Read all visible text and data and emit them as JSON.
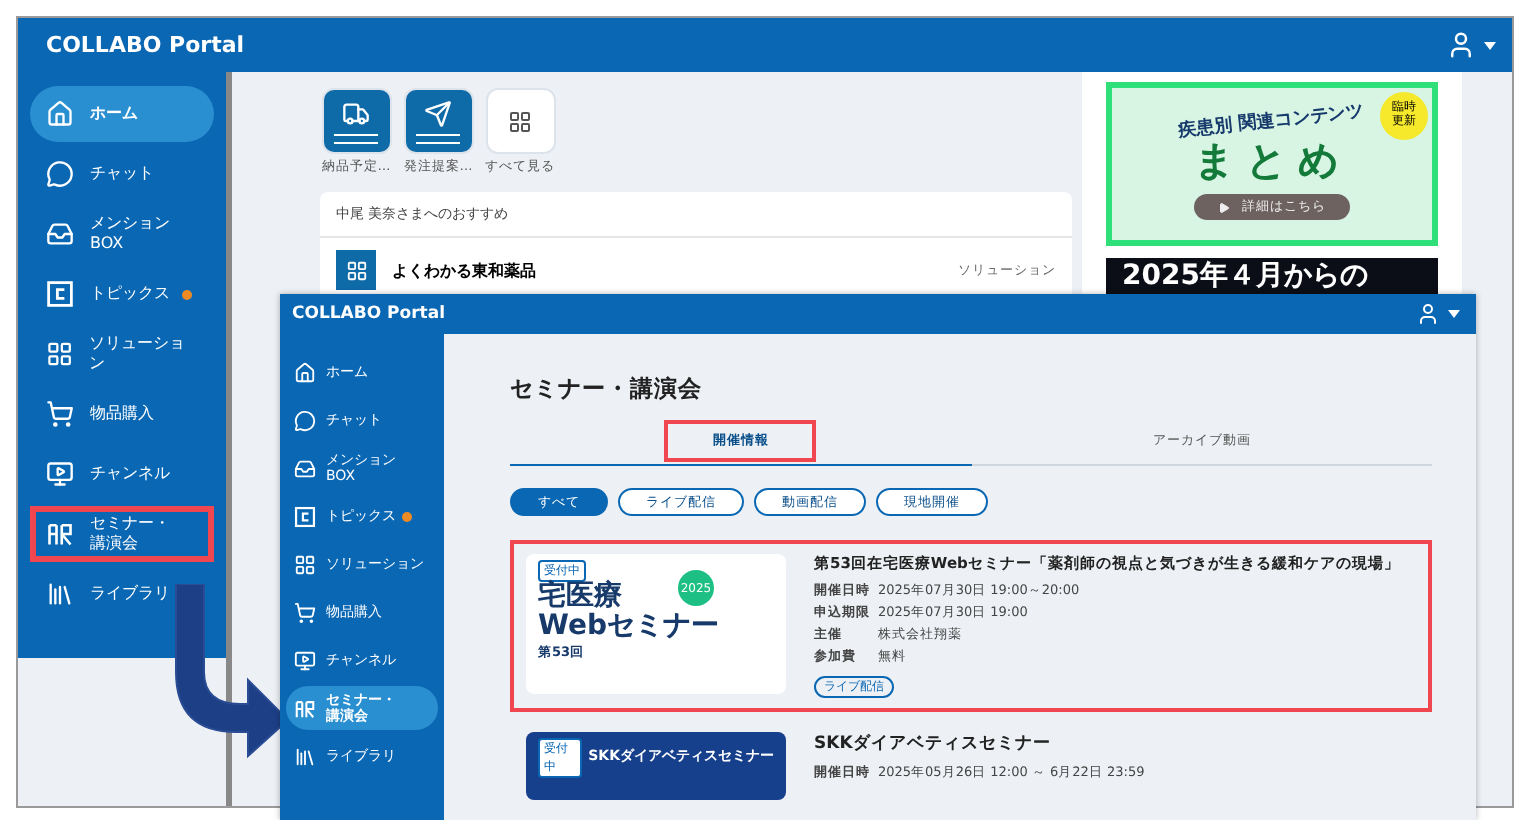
{
  "back_window": {
    "title": "COLLABO Portal",
    "sidebar": {
      "items": [
        {
          "label": "ホーム",
          "selected": true,
          "dot": false,
          "highlighted": false
        },
        {
          "label": "チャット",
          "selected": false,
          "dot": false,
          "highlighted": false
        },
        {
          "label": "メンション\nBOX",
          "selected": false,
          "dot": false,
          "highlighted": false
        },
        {
          "label": "トピックス",
          "selected": false,
          "dot": true,
          "highlighted": false
        },
        {
          "label": "ソリューション",
          "selected": false,
          "dot": false,
          "highlighted": false
        },
        {
          "label": "物品購入",
          "selected": false,
          "dot": false,
          "highlighted": false
        },
        {
          "label": "チャンネル",
          "selected": false,
          "dot": false,
          "highlighted": false
        },
        {
          "label": "セミナー・講演会",
          "selected": false,
          "dot": false,
          "highlighted": true
        },
        {
          "label": "ライブラリ",
          "selected": false,
          "dot": false,
          "highlighted": false
        }
      ]
    },
    "apps": [
      {
        "kind": "truck",
        "label": "納品予定…"
      },
      {
        "kind": "plane",
        "label": "発注提案…"
      },
      {
        "kind": "all",
        "label": "すべて見る"
      }
    ],
    "recommend": {
      "heading": "中尾 美奈さまへのおすすめ",
      "items": [
        {
          "title": "よくわかる東和薬品",
          "tag": "ソリューション"
        }
      ]
    },
    "banners": [
      {
        "kind": "flowers",
        "title": "疾患別 関連コンテンツ",
        "main": "まとめ",
        "badge": "臨時更新",
        "button": "詳細はこちら"
      },
      {
        "kind": "dark",
        "main": "2025年４月からの"
      }
    ]
  },
  "front_window": {
    "title": "COLLABO Portal",
    "sidebar": {
      "items": [
        {
          "label": "ホーム",
          "selected": false,
          "dot": false
        },
        {
          "label": "チャット",
          "selected": false,
          "dot": false
        },
        {
          "label": "メンション\nBOX",
          "selected": false,
          "dot": false
        },
        {
          "label": "トピックス",
          "selected": false,
          "dot": true
        },
        {
          "label": "ソリューション",
          "selected": false,
          "dot": false
        },
        {
          "label": "物品購入",
          "selected": false,
          "dot": false
        },
        {
          "label": "チャンネル",
          "selected": false,
          "dot": false
        },
        {
          "label": "セミナー・講演会",
          "selected": true,
          "dot": false
        },
        {
          "label": "ライブラリ",
          "selected": false,
          "dot": false
        }
      ]
    },
    "page_title": "セミナー・講演会",
    "tabs": [
      {
        "label": "開催情報",
        "selected": true,
        "highlighted": true
      },
      {
        "label": "アーカイブ動画",
        "selected": false,
        "highlighted": false
      }
    ],
    "filters": [
      {
        "label": "すべて",
        "selected": true
      },
      {
        "label": "ライブ配信",
        "selected": false
      },
      {
        "label": "動画配信",
        "selected": false
      },
      {
        "label": "現地開催",
        "selected": false
      }
    ],
    "seminars": [
      {
        "kind": "light",
        "highlighted": true,
        "thumbnail": {
          "badge": "受付中",
          "line1": "宅医療",
          "line2": "Webセミナー",
          "year": "2025",
          "sub": "第53回"
        },
        "title": "第53回在宅医療Webセミナー「薬剤師の視点と気づきが生きる緩和ケアの現場」",
        "rows": [
          {
            "label": "開催日時",
            "value": "2025年07月30日 19:00～20:00"
          },
          {
            "label": "申込期限",
            "value": "2025年07月30日 19:00"
          },
          {
            "label": "主催",
            "value": "株式会社翔薬"
          },
          {
            "label": "参加費",
            "value": "無料"
          }
        ],
        "tags": [
          "ライブ配信"
        ]
      },
      {
        "kind": "dark",
        "highlighted": false,
        "thumbnail": {
          "badge": "受付中",
          "line1": "SKKダイアベティスセミナー"
        },
        "title": "SKKダイアベティスセミナー",
        "rows": [
          {
            "label": "開催日時",
            "value": "2025年05月26日 12:00 ～ 6月22日 23:59"
          }
        ]
      }
    ]
  }
}
